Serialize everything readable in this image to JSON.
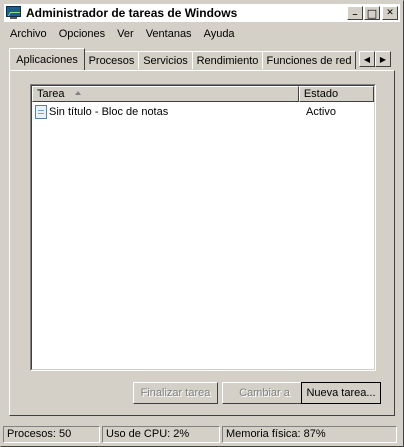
{
  "window": {
    "title": "Administrador de tareas de Windows",
    "minimize_glyph": "_",
    "maximize_glyph": "□",
    "close_glyph": "✕"
  },
  "menu": {
    "items": [
      "Archivo",
      "Opciones",
      "Ver",
      "Ventanas",
      "Ayuda"
    ]
  },
  "tabs": {
    "items": [
      "Aplicaciones",
      "Procesos",
      "Servicios",
      "Rendimiento",
      "Funciones de red"
    ],
    "active": "Aplicaciones",
    "scroll_left": "◀",
    "scroll_right": "▶"
  },
  "task_list": {
    "columns": [
      "Tarea",
      "Estado"
    ],
    "sort_column": "Tarea",
    "rows": [
      {
        "name": "Sin título - Bloc de notas",
        "status": "Activo",
        "icon": "notepad-icon"
      }
    ]
  },
  "buttons": {
    "end_task": "Finalizar tarea",
    "switch_to": "Cambiar a",
    "new_task": "Nueva tarea..."
  },
  "statusbar": {
    "processes": "Procesos: 50",
    "cpu": "Uso de CPU: 2%",
    "memory": "Memoria física: 87%"
  },
  "colors": {
    "face": "#d4d0c8",
    "disabled_text": "#808080"
  }
}
